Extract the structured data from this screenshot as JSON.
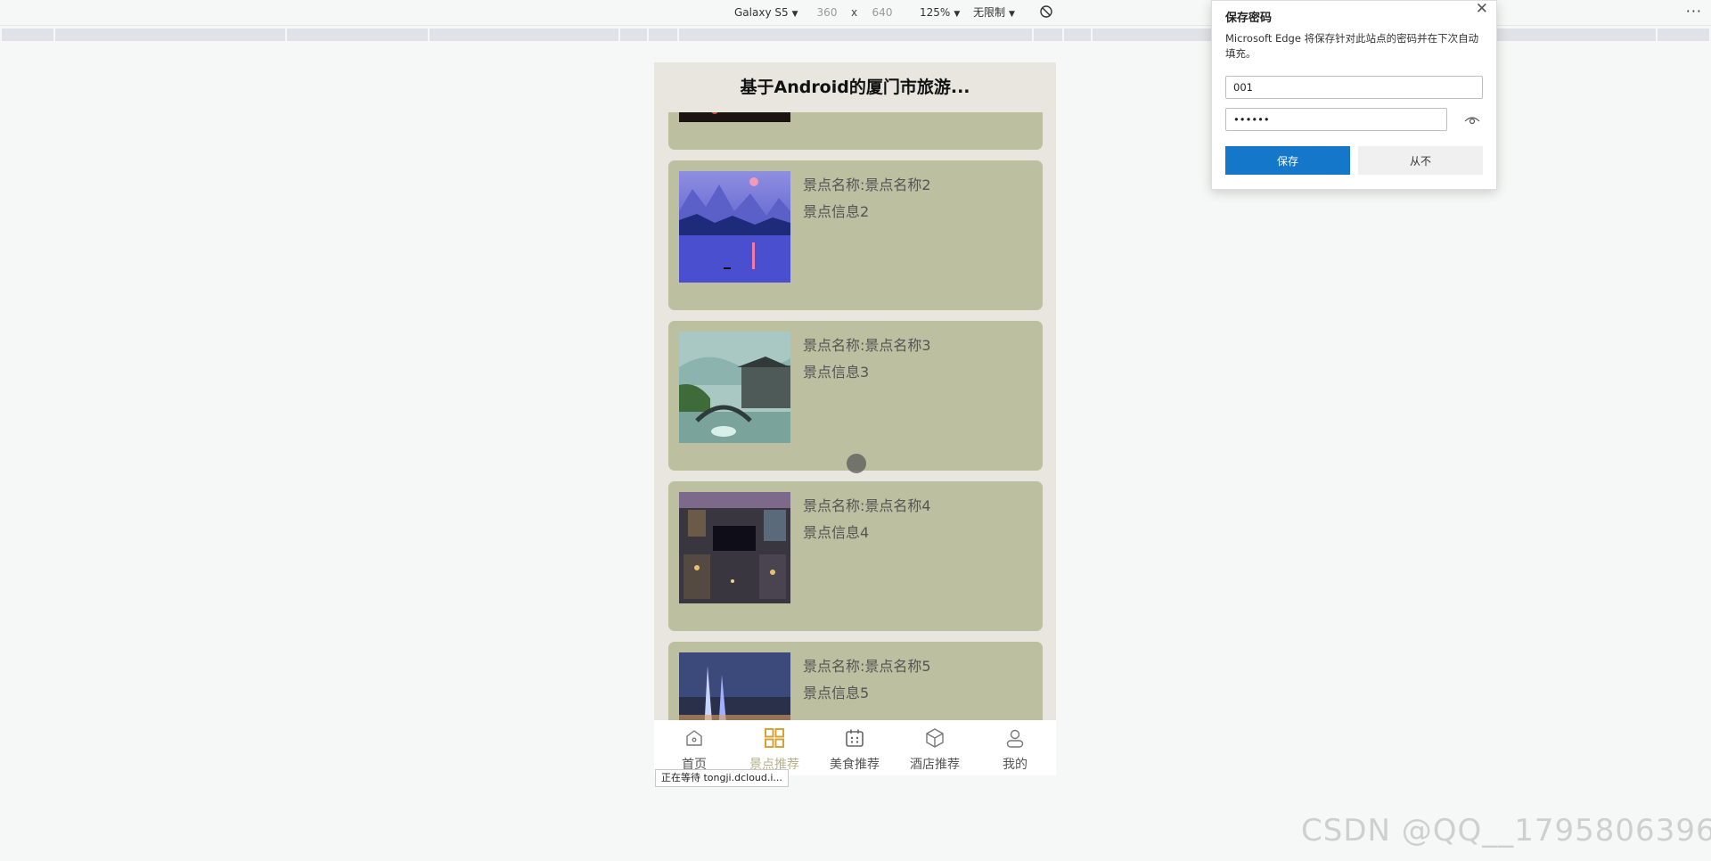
{
  "toolbar": {
    "device": "Galaxy S5",
    "width": "360",
    "x": "x",
    "height": "640",
    "zoom": "125%",
    "throttle": "无限制",
    "more": "···"
  },
  "app": {
    "title": "基于Android的厦门市旅游..."
  },
  "cards": [
    {
      "name": "景点名称:景点名称2",
      "info": "景点信息2"
    },
    {
      "name": "景点名称:景点名称3",
      "info": "景点信息3"
    },
    {
      "name": "景点名称:景点名称4",
      "info": "景点信息4"
    },
    {
      "name": "景点名称:景点名称5",
      "info": "景点信息5"
    }
  ],
  "tabs": [
    {
      "label": "首页",
      "icon": "home-icon"
    },
    {
      "label": "景点推荐",
      "icon": "grid-icon",
      "active": true
    },
    {
      "label": "美食推荐",
      "icon": "calendar-icon"
    },
    {
      "label": "酒店推荐",
      "icon": "box-icon"
    },
    {
      "label": "我的",
      "icon": "user-icon"
    }
  ],
  "status_tip": "正在等待 tongji.dcloud.i...",
  "popup": {
    "title": "保存密码",
    "close": "✕",
    "description": "Microsoft Edge 将保存针对此站点的密码并在下次自动填充。",
    "username": "001",
    "password": "••••••",
    "save_label": "保存",
    "never_label": "从不"
  },
  "watermark": "CSDN @QQ__1795806396",
  "colors": {
    "card": "#bcbfa0",
    "accent": "#b7b38a",
    "save_button": "#1477c9"
  }
}
